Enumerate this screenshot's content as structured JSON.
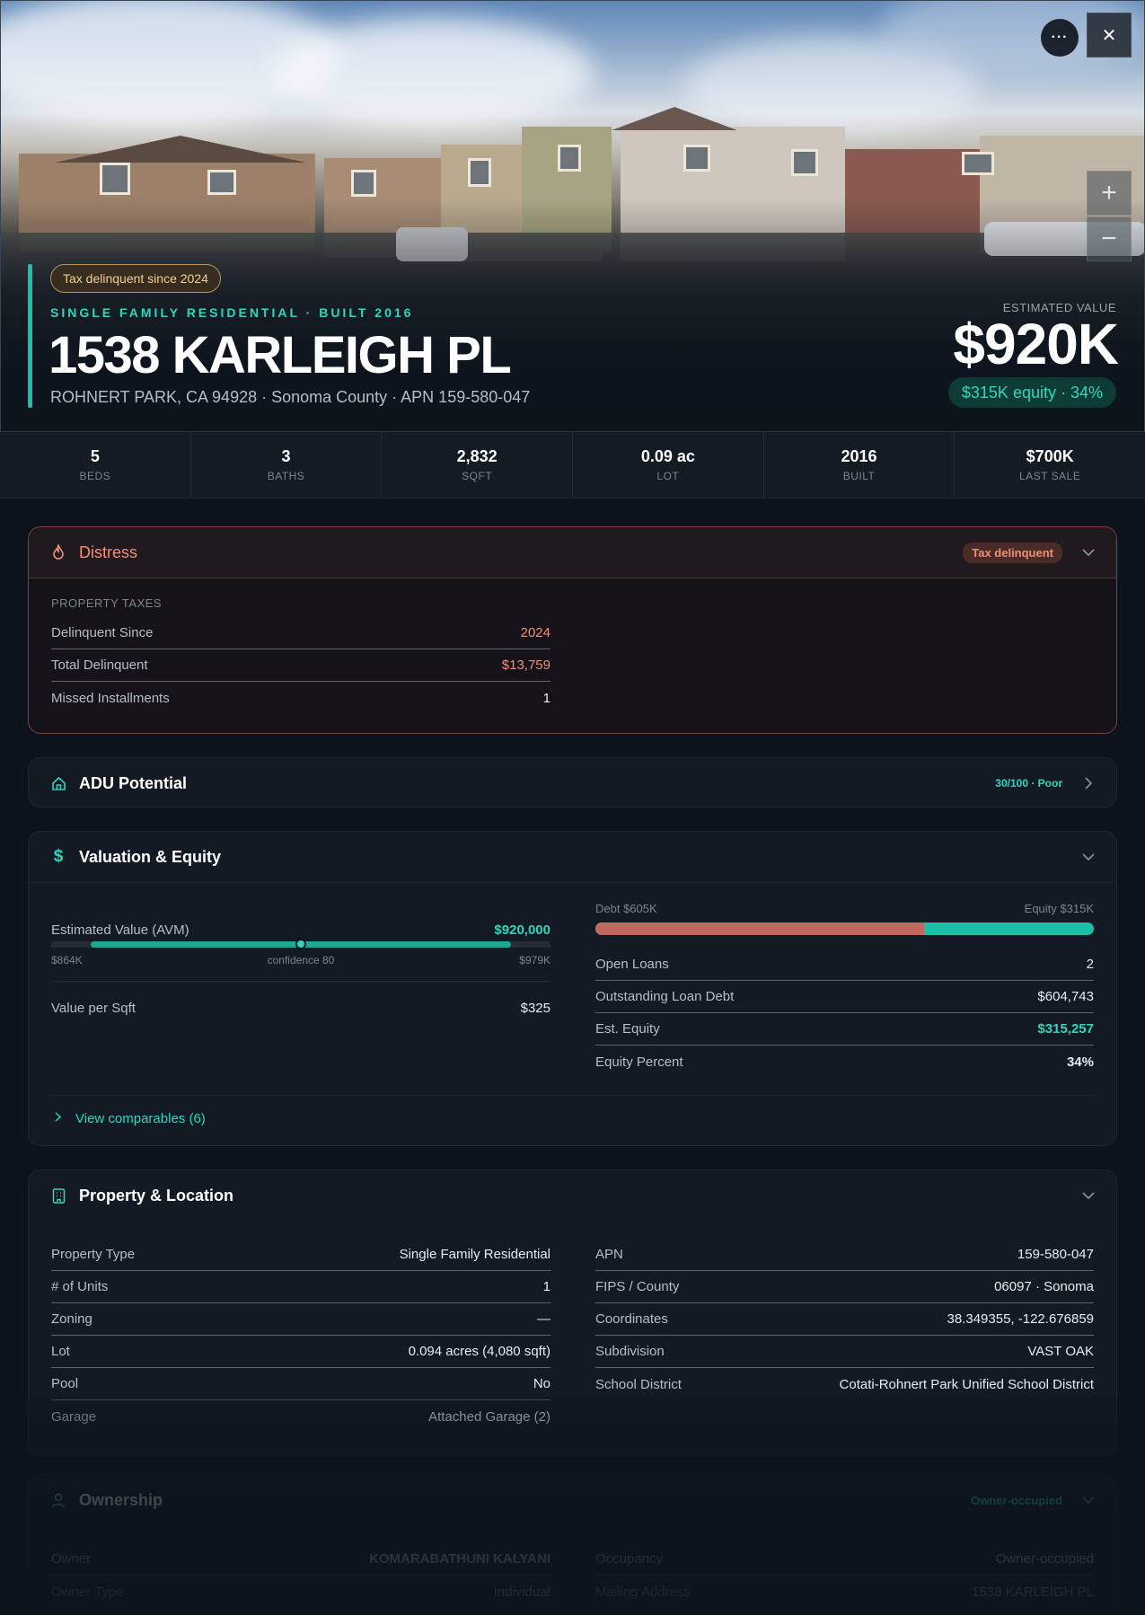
{
  "hero": {
    "tax_badge": "Tax delinquent since 2024",
    "property_kind": "SINGLE FAMILY RESIDENTIAL · BUILT 2016",
    "address": "1538 KARLEIGH PL",
    "sub_address": "ROHNERT PARK, CA 94928 · Sonoma County · APN 159-580-047",
    "estimated_label": "ESTIMATED VALUE",
    "estimated_value": "$920K",
    "equity_badge": "$315K equity · 34%",
    "more_glyph": "···",
    "close_glyph": "✕",
    "zoom_in_glyph": "+",
    "zoom_out_glyph": "−"
  },
  "stats": [
    {
      "value": "5",
      "label": "BEDS"
    },
    {
      "value": "3",
      "label": "BATHS"
    },
    {
      "value": "2,832",
      "label": "SQFT"
    },
    {
      "value": "0.09 ac",
      "label": "LOT"
    },
    {
      "value": "2016",
      "label": "BUILT"
    },
    {
      "value": "$700K",
      "label": "LAST SALE"
    }
  ],
  "distress": {
    "title": "Distress",
    "badge": "Tax delinquent",
    "section": "PROPERTY TAXES",
    "rows": [
      {
        "k": "Delinquent Since",
        "v": "2024"
      },
      {
        "k": "Total Delinquent",
        "v": "$13,759"
      },
      {
        "k": "Missed Installments",
        "v": "1"
      }
    ]
  },
  "adu": {
    "title": "ADU Potential",
    "badge": "30/100 · Poor"
  },
  "valuation": {
    "title": "Valuation & Equity",
    "avm_label": "Estimated Value (AVM)",
    "avm_value": "$920,000",
    "range_low": "$864K",
    "confidence": "confidence 80",
    "range_high": "$979K",
    "avm_position": 0.5,
    "range_start": 0.08,
    "range_end": 0.92,
    "psf_label": "Value per Sqft",
    "psf_value": "$325",
    "debt_label": "Debt $605K",
    "equity_label": "Equity $315K",
    "debt_fraction": 0.66,
    "right_rows": [
      {
        "k": "Open Loans",
        "v": "2"
      },
      {
        "k": "Outstanding Loan Debt",
        "v": "$604,743"
      },
      {
        "k": "Est. Equity",
        "v": "$315,257"
      },
      {
        "k": "Equity Percent",
        "v": "34%"
      }
    ],
    "comparables": "View comparables (6)"
  },
  "location": {
    "title": "Property & Location",
    "left_rows": [
      {
        "k": "Property Type",
        "v": "Single Family Residential"
      },
      {
        "k": "# of Units",
        "v": "1"
      },
      {
        "k": "Zoning",
        "v": "—"
      },
      {
        "k": "Lot",
        "v": "0.094 acres (4,080 sqft)"
      },
      {
        "k": "Pool",
        "v": "No"
      },
      {
        "k": "Garage",
        "v": "Attached Garage (2)"
      }
    ],
    "right_rows": [
      {
        "k": "APN",
        "v": "159-580-047"
      },
      {
        "k": "FIPS / County",
        "v": "06097 · Sonoma"
      },
      {
        "k": "Coordinates",
        "v": "38.349355, -122.676859"
      },
      {
        "k": "Subdivision",
        "v": "VAST OAK"
      },
      {
        "k": "School District",
        "v": "Cotati-Rohnert Park Unified School District"
      }
    ]
  },
  "ownership": {
    "title": "Ownership",
    "badge": "Owner-occupied",
    "left_rows": [
      {
        "k": "Owner",
        "v": "KOMARABATHUNI KALYANI"
      },
      {
        "k": "Owner Type",
        "v": "Individual"
      }
    ],
    "right_rows": [
      {
        "k": "Occupancy",
        "v": "Owner-occupied"
      },
      {
        "k": "Mailing Address",
        "v": "1538 KARLEIGH PL"
      }
    ]
  },
  "colors": {
    "accent": "#1cc0a8",
    "distress": "#f08f73",
    "debt": "#c0695c",
    "equity": "#1cc0a8"
  }
}
